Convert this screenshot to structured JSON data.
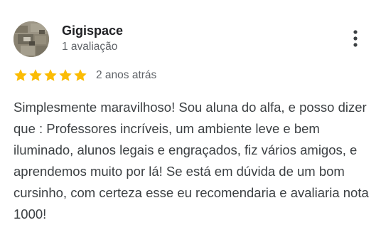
{
  "review": {
    "reviewer_name": "Gigispace",
    "review_count": "1 avaliação",
    "date": "2 anos atrás",
    "rating": 5,
    "rating_max": 5,
    "text": "Simplesmente maravilhoso! Sou aluna do alfa, e posso dizer que : Professores incríveis, um ambiente leve e bem iluminado, alunos legais e engraçados, fiz vários amigos, e aprendemos muito por lá! Se está em dúvida de um bom cursinho, com certeza esse eu recomendaria e avaliaria nota 1000!"
  },
  "icons": {
    "avatar": "avatar-photo",
    "menu": "more-vert-icon",
    "star": "star-icon"
  },
  "colors": {
    "star": "#fbbc04",
    "name": "#202124",
    "meta": "#5f6368",
    "body": "#3c4043"
  }
}
